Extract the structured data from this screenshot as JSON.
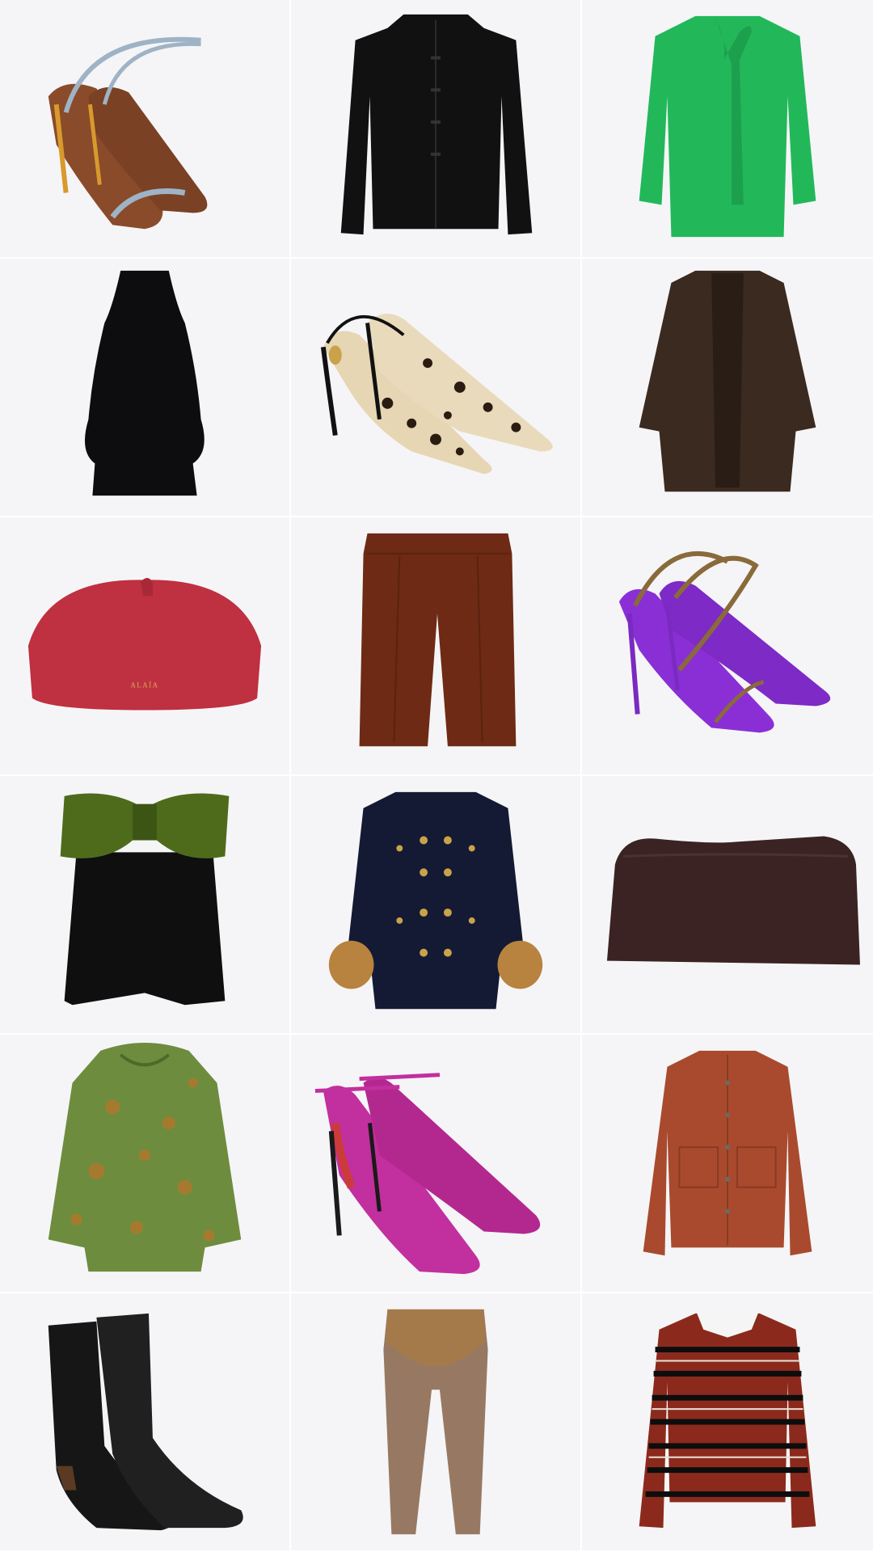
{
  "products": [
    {
      "id": "p1",
      "kind": "sandal",
      "name": "strappy-sandal-brown-quilted",
      "colors": {
        "main": "#8a4b2a",
        "strap": "#9fb3c6",
        "heel": "#d89a2c"
      }
    },
    {
      "id": "p2",
      "kind": "jacket",
      "name": "black-mandarin-jacket",
      "colors": {
        "main": "#111111"
      }
    },
    {
      "id": "p3",
      "kind": "blouse",
      "name": "green-bow-blouse",
      "colors": {
        "main": "#22b85a"
      }
    },
    {
      "id": "p4",
      "kind": "halter-top",
      "name": "black-halter-top",
      "colors": {
        "main": "#0d0d10"
      }
    },
    {
      "id": "p5",
      "kind": "slingback",
      "name": "leopard-slingback-pumps",
      "colors": {
        "main": "#e6d6b4",
        "spot": "#2a1c10",
        "trim": "#111111"
      }
    },
    {
      "id": "p6",
      "kind": "coat",
      "name": "brown-shearling-coat",
      "colors": {
        "main": "#3b2a20"
      }
    },
    {
      "id": "p7",
      "kind": "clutch",
      "name": "red-suede-pouch-bag",
      "colors": {
        "main": "#bf3040"
      },
      "brand": "ALAÏA"
    },
    {
      "id": "p8",
      "kind": "shorts",
      "name": "rust-pleated-bermuda-shorts",
      "colors": {
        "main": "#6e2a14"
      }
    },
    {
      "id": "p9",
      "kind": "sandal",
      "name": "purple-quilted-strappy-sandal",
      "colors": {
        "main": "#8a2fd6",
        "strap": "#8a6a3a",
        "heel": "#7a2ac0"
      }
    },
    {
      "id": "p10",
      "kind": "bow-top",
      "name": "black-top-green-bow",
      "colors": {
        "main": "#0f0f0f",
        "bow": "#4e6b1c"
      }
    },
    {
      "id": "p11",
      "kind": "tweed-jacket",
      "name": "navy-jacket-fur-cuffs",
      "colors": {
        "main": "#141a33",
        "button": "#c9a24a",
        "fur": "#b7833e"
      }
    },
    {
      "id": "p12",
      "kind": "clutch-flat",
      "name": "dark-brown-leather-clutch",
      "colors": {
        "main": "#3a2322"
      }
    },
    {
      "id": "p13",
      "kind": "puffer",
      "name": "green-brocade-puffer-jacket",
      "colors": {
        "main": "#6e8c3e",
        "pattern": "#b0782c"
      }
    },
    {
      "id": "p14",
      "kind": "pump",
      "name": "pink-satin-ankle-strap-pump",
      "colors": {
        "main": "#c22f9e",
        "sole": "#cc3b3b",
        "heel": "#1a1a1a"
      }
    },
    {
      "id": "p15",
      "kind": "denim-jacket",
      "name": "rust-denim-jacket",
      "colors": {
        "main": "#a94a2e"
      }
    },
    {
      "id": "p16",
      "kind": "boots",
      "name": "black-leather-ankle-boots",
      "colors": {
        "main": "#161616",
        "heel": "#5a3a22"
      }
    },
    {
      "id": "p17",
      "kind": "leggings",
      "name": "sheer-tan-leggings",
      "colors": {
        "main": "#8d6b52",
        "band": "#a57a4a"
      }
    },
    {
      "id": "p18",
      "kind": "polo",
      "name": "striped-rugby-polo",
      "colors": {
        "main": "#8b2a1c",
        "stripe": "#0d0d0d",
        "accent": "#e8e1d8",
        "collar": "#f5f5f5"
      }
    }
  ]
}
